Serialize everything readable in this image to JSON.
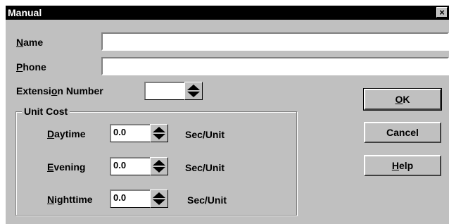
{
  "window": {
    "title": "Manual",
    "close_label": "×"
  },
  "fields": {
    "name": {
      "label_u": "N",
      "label_rest": "ame",
      "value": ""
    },
    "phone": {
      "label_u": "P",
      "label_rest": "hone",
      "value": ""
    },
    "extension": {
      "label_pre": "Extensi",
      "label_u": "o",
      "label_rest": "n Number",
      "value": ""
    }
  },
  "unit_cost": {
    "title": "Unit Cost",
    "rows": [
      {
        "label_u": "D",
        "label_rest": "aytime",
        "value": "0.0",
        "unit": "Sec/Unit"
      },
      {
        "label_u": "E",
        "label_rest": "vening",
        "value": "0.0",
        "unit": "Sec/Unit"
      },
      {
        "label_u": "N",
        "label_rest": "ighttime",
        "value": "0.0",
        "unit": "Sec/Unit"
      }
    ]
  },
  "buttons": {
    "ok": {
      "label_u": "O",
      "label_rest": "K"
    },
    "cancel": {
      "label": "Cancel"
    },
    "help": {
      "label_u": "H",
      "label_rest": "elp"
    }
  }
}
